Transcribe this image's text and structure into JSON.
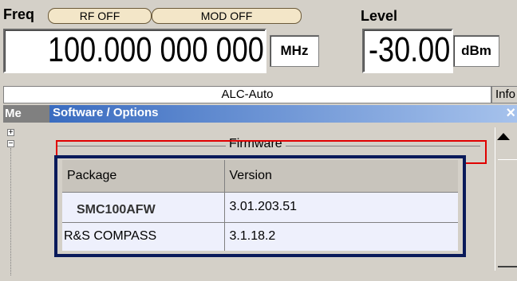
{
  "header": {
    "freq_label": "Freq",
    "rf_off": "RF OFF",
    "mod_off": "MOD OFF",
    "level_label": "Level",
    "frequency_value": "100.000 000 000",
    "frequency_unit": "MHz",
    "level_value": "-30.00",
    "level_unit": "dBm"
  },
  "status": {
    "alc": "ALC-Auto",
    "info_button": "Info"
  },
  "menu_tab": "Me",
  "dialog": {
    "title": "Software / Options",
    "close": "×",
    "section_title": "Firmware",
    "columns": [
      "Package",
      "Version"
    ],
    "rows": [
      {
        "package": "SMC100AFW",
        "version": "3.01.203.51"
      },
      {
        "package": "R&S COMPASS",
        "version": "3.1.18.2"
      }
    ]
  },
  "colors": {
    "title_start": "#3a6cc0",
    "table_border": "#0a1a5a",
    "highlight": "#e00000"
  }
}
